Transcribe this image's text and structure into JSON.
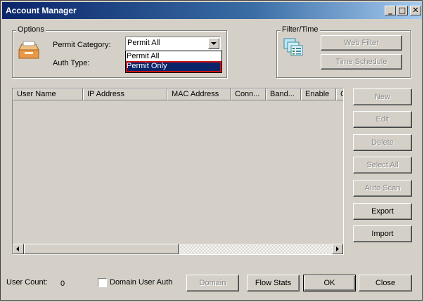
{
  "window": {
    "title": "Account Manager",
    "minimize": "_",
    "maximize": "□",
    "close": "✕"
  },
  "options": {
    "group_label": "Options",
    "permit_category_label": "Permit Category:",
    "permit_category_value": "Permit All",
    "dropdown_options": [
      "Permit All",
      "Permit Only"
    ],
    "auth_type_label": "Auth Type:"
  },
  "filter_time": {
    "group_label": "Filter/Time",
    "web_filter": "Web Filter",
    "time_schedule": "Time Schedule"
  },
  "table": {
    "columns": [
      "User Name",
      "IP Address",
      "MAC Address",
      "Conn...",
      "Band...",
      "Enable",
      "C"
    ]
  },
  "side_buttons": {
    "new": "New",
    "edit": "Edit",
    "delete": "Delete",
    "select_all": "Select All",
    "auto_scan": "Auto Scan",
    "export": "Export",
    "import": "Import"
  },
  "footer": {
    "user_count_label": "User Count:",
    "user_count_value": "0",
    "domain_user_auth": "Domain User Auth",
    "domain": "Domain",
    "flow_stats": "Flow Stats",
    "ok": "OK",
    "close": "Close"
  }
}
